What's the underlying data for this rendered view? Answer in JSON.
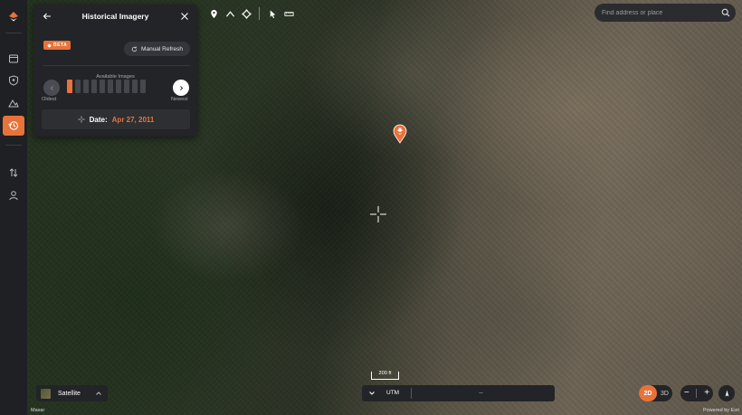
{
  "panel": {
    "title": "Historical Imagery",
    "beta_label": "BETA",
    "refresh_label": "Manual Refresh",
    "available_label": "Available Images",
    "oldest_label": "Oldest",
    "newest_label": "Newest",
    "date_label": "Date:",
    "date_value": "Apr 27, 2011",
    "image_count": 10,
    "selected_index": 0
  },
  "search": {
    "placeholder": "Find address or place"
  },
  "basemap": {
    "name": "Satellite"
  },
  "coords": {
    "system": "UTM",
    "value": "--"
  },
  "view": {
    "mode_2d": "2D",
    "mode_3d": "3D",
    "active": "2D"
  },
  "zoom": {
    "minus": "−",
    "plus": "+"
  },
  "scale": {
    "label": "200 ft"
  },
  "attribution": {
    "left": "Maxar",
    "right": "Powered by Esri"
  },
  "colors": {
    "accent": "#e8733a",
    "panel": "#232427",
    "rail": "#1f2023"
  },
  "rail_icons": [
    "logo-icon",
    "layers-icon",
    "shield-icon",
    "terrain-icon",
    "history-icon",
    "transfer-icon",
    "user-icon"
  ],
  "toolbar_icons": [
    "marker-icon",
    "line-icon",
    "shape-icon",
    "cursor-icon",
    "ruler-icon"
  ]
}
